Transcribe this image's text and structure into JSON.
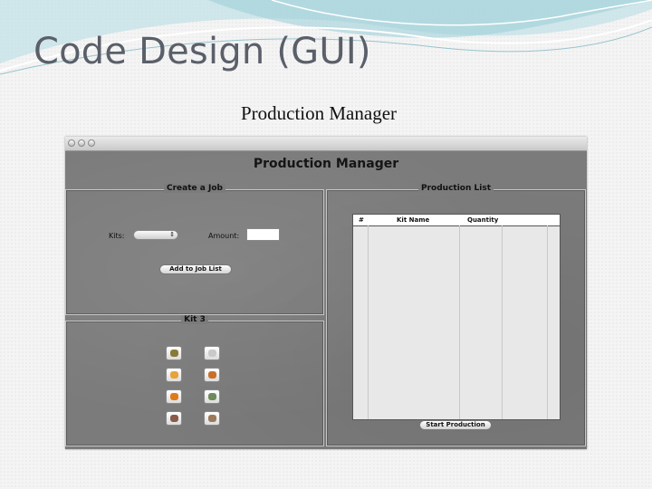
{
  "slide": {
    "title": "Code Design (GUI)",
    "subtitle": "Production Manager"
  },
  "window": {
    "app_title": "Production Manager",
    "create_panel": {
      "title": "Create a Job",
      "kits_label": "Kits:",
      "kits_value": "",
      "amount_label": "Amount:",
      "amount_value": "",
      "add_button": "Add to Job List"
    },
    "kit_panel": {
      "title": "Kit 3",
      "parts": [
        {
          "icon": "part-icon-1",
          "color": "#8a7a3a"
        },
        {
          "icon": "part-icon-2",
          "color": "#c9c9c9"
        },
        {
          "icon": "part-icon-3",
          "color": "#e8a23a"
        },
        {
          "icon": "part-icon-4",
          "color": "#c8702a"
        },
        {
          "icon": "part-icon-5",
          "color": "#e07b1a"
        },
        {
          "icon": "part-icon-6",
          "color": "#6f8a5a"
        },
        {
          "icon": "part-icon-7",
          "color": "#8a5a4a"
        },
        {
          "icon": "part-icon-8",
          "color": "#9a7a5a"
        }
      ]
    },
    "production_panel": {
      "title": "Production List",
      "columns": [
        "#",
        "Kit Name",
        "Quantity"
      ],
      "start_button": "Start Production"
    }
  }
}
